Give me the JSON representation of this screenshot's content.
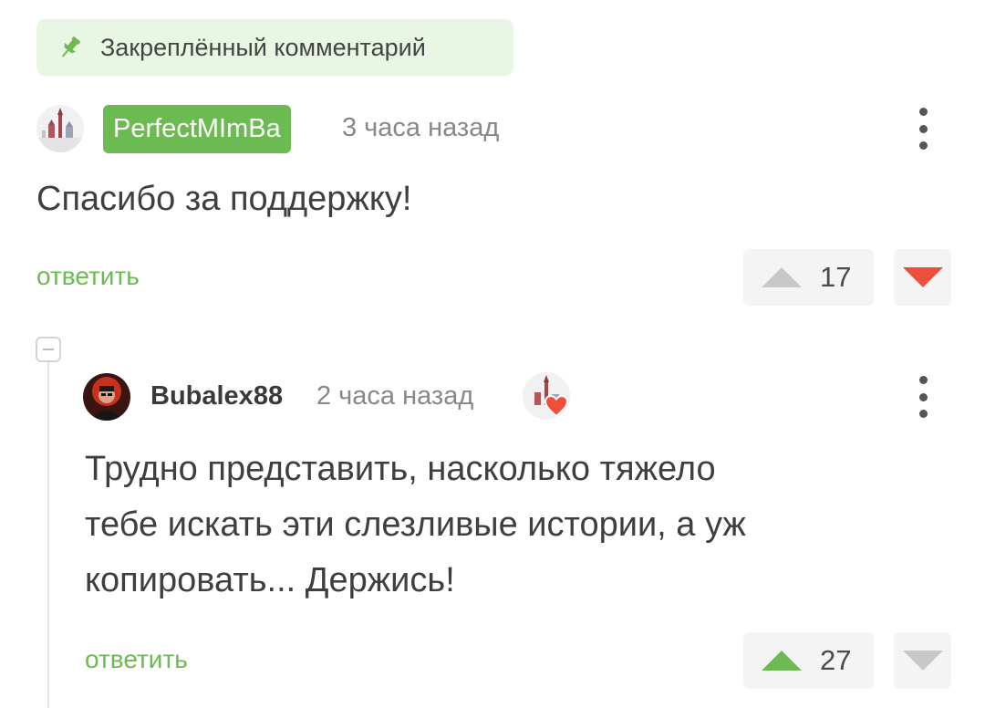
{
  "pinned": {
    "label": "Закреплённый комментарий",
    "icon": "pin-icon"
  },
  "comments": [
    {
      "author": "PerfectMImBa",
      "time": "3 часа назад",
      "text": "Спасибо за поддержку!",
      "reply_label": "ответить",
      "rating": "17",
      "vote_state": "downvoted"
    },
    {
      "author": "Bubalex88",
      "time": "2 часа назад",
      "text_lines": [
        "Трудно представить, насколько тяжело",
        "тебе искать эти слезливые истории, а уж",
        "копировать... Держись!"
      ],
      "reply_label": "ответить",
      "rating": "27",
      "vote_state": "upvoted"
    }
  ],
  "colors": {
    "accent": "#6cba52",
    "downvote": "#ee4e3a",
    "pinned_bg": "#eaf6e4",
    "neutral": "#c8c8c8"
  }
}
